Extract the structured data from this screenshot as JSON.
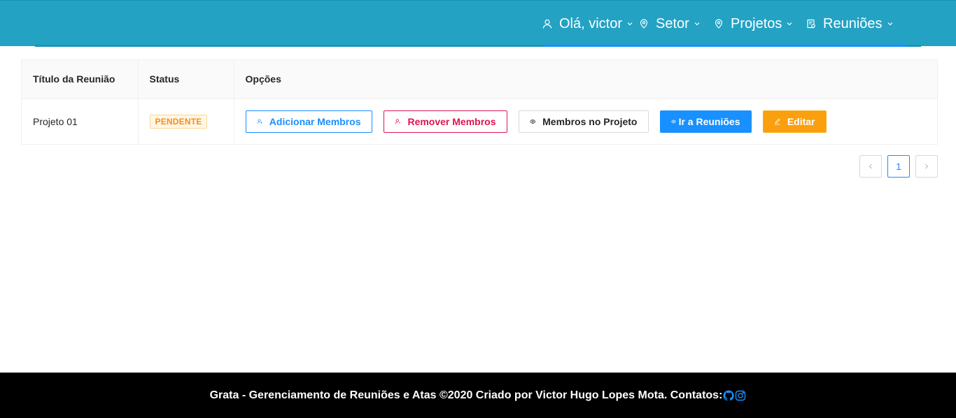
{
  "header": {
    "background": "#23a2c4",
    "nav": [
      {
        "label": "Olá, victor",
        "icon": "user-icon"
      },
      {
        "label": "Setor",
        "icon": "location-pin-icon"
      },
      {
        "label": "Projetos",
        "icon": "location-pin-icon"
      },
      {
        "label": "Reuniões",
        "icon": "calendar-doc-icon"
      }
    ]
  },
  "table": {
    "columns": [
      "Título da Reunião",
      "Status",
      "Opções"
    ],
    "rows": [
      {
        "title": "Projeto 01",
        "status": "PENDENTE",
        "actions": {
          "add_members": "Adicionar Membros",
          "remove_members": "Remover Membros",
          "project_members": "Membros no Projeto",
          "go_meetings": "Ir a Reuniões",
          "edit": "Editar"
        }
      }
    ]
  },
  "pagination": {
    "current_page": "1"
  },
  "footer": {
    "text": "Grata - Gerenciamento de Reuniões e Atas ©2020 Criado por Victor Hugo Lopes Mota. Contatos:",
    "icons": [
      "github-icon",
      "instagram-icon"
    ]
  },
  "colors": {
    "primary": "#1890ff",
    "danger": "#e0134f",
    "warning": "#fa9f0e",
    "tag_orange": "#fa8c16"
  }
}
